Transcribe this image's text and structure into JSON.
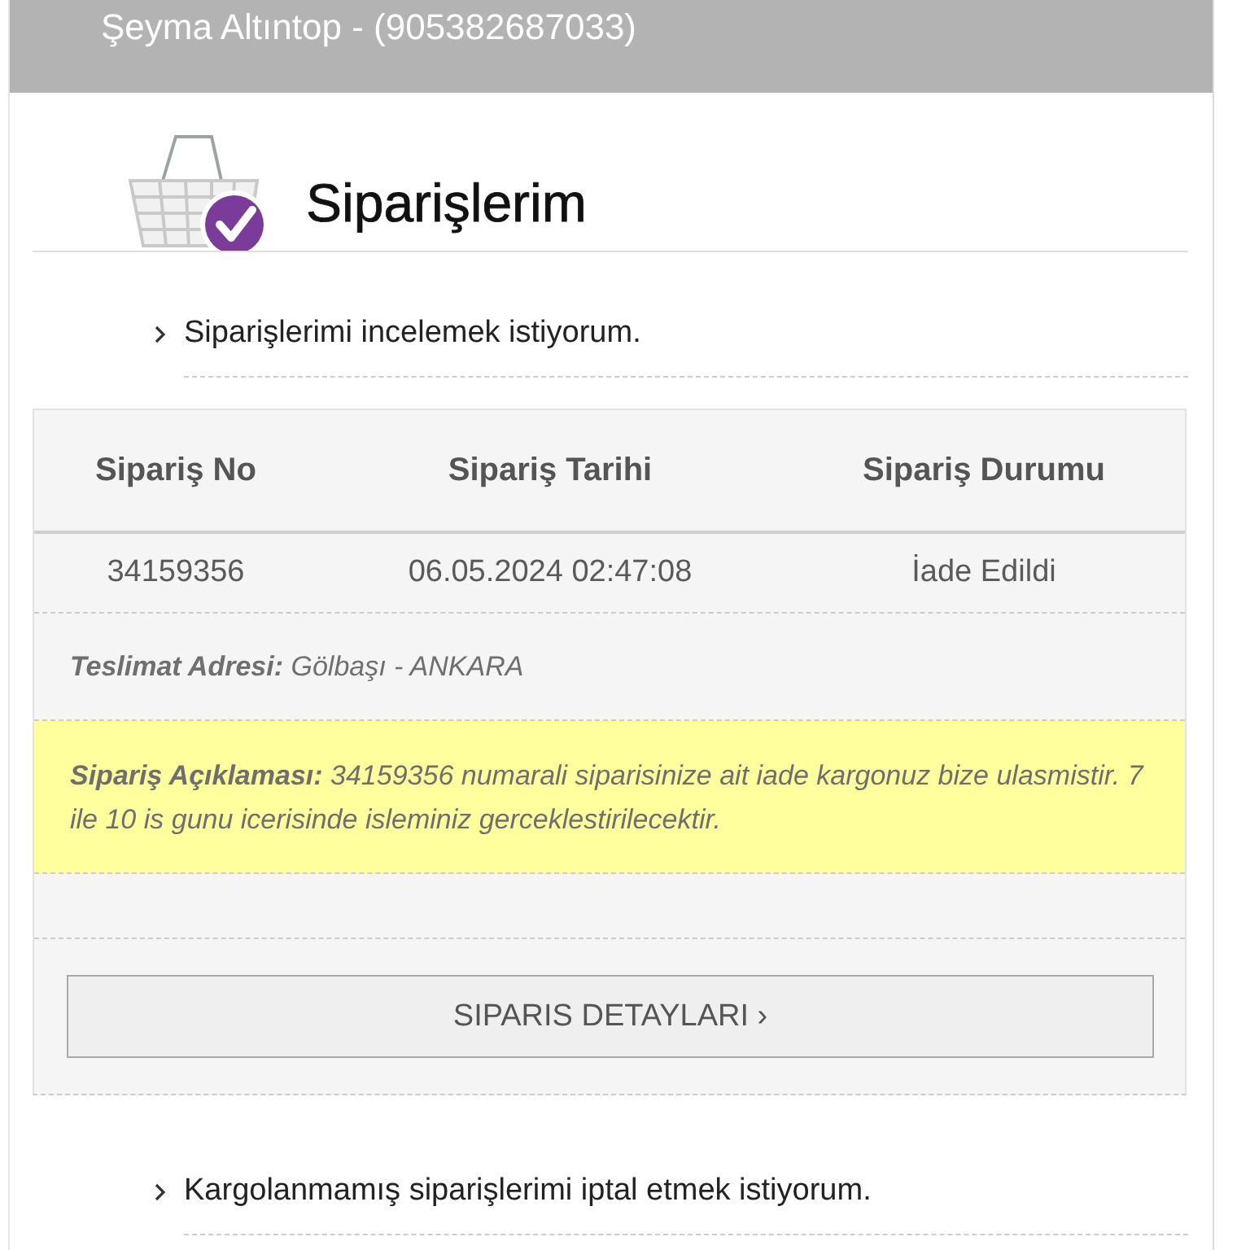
{
  "header": {
    "title": "Şeyma Altıntop - (905382687033)"
  },
  "page": {
    "title": "Siparişlerim"
  },
  "sections": [
    {
      "label": "Siparişlerimi incelemek istiyorum.",
      "order": {
        "columns": [
          "Sipariş No",
          "Sipariş Tarihi",
          "Sipariş Durumu"
        ],
        "rows": [
          {
            "cells": [
              "34159356",
              "06.05.2024 02:47:08",
              "İade Edildi"
            ]
          }
        ],
        "address": "**Teslimat Adresi:** Gölbaşı - ANKARA",
        "note": "**Sipariş Açıklaması:** 34159356 numarali siparisinize ait iade kargonuz bize ulasmistir. 7 ile 10 is gunu icerisinde isleminiz gerceklestirilecektir.",
        "button": "SIPARIS DETAYLARI ›"
      }
    },
    {
      "label": "Kargolanmamış siparişlerimi iptal etmek istiyorum."
    }
  ]
}
